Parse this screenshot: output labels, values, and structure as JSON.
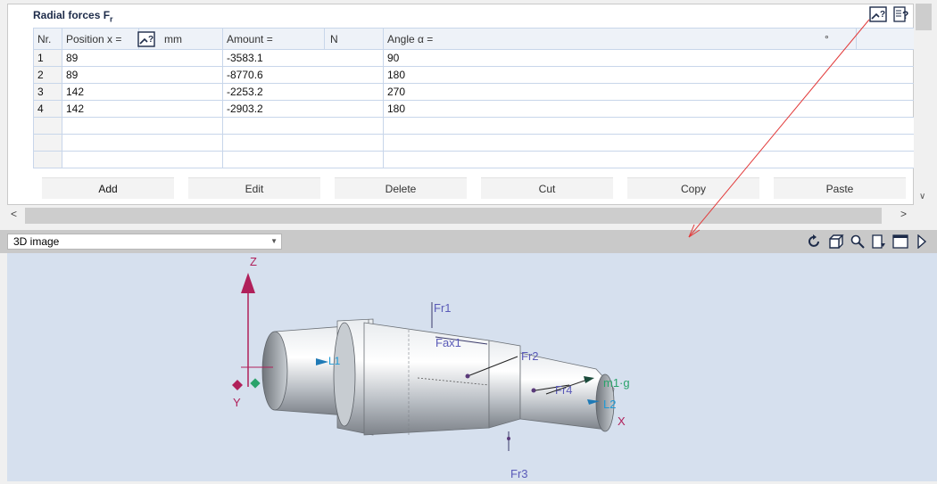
{
  "section": {
    "title": "Radial forces F",
    "title_sub": "r"
  },
  "table": {
    "headers": {
      "nr": "Nr.",
      "position": "Position x =",
      "position_unit": "mm",
      "amount": "Amount =",
      "amount_unit": "N",
      "angle": "Angle α =",
      "angle_unit": "°"
    },
    "rows": [
      {
        "nr": "1",
        "position": "89",
        "amount": "-3583.1",
        "angle": "90"
      },
      {
        "nr": "2",
        "position": "89",
        "amount": "-8770.6",
        "angle": "180"
      },
      {
        "nr": "3",
        "position": "142",
        "amount": "-2253.2",
        "angle": "270"
      },
      {
        "nr": "4",
        "position": "142",
        "amount": "-2903.2",
        "angle": "180"
      }
    ]
  },
  "buttons": {
    "add": "Add",
    "edit": "Edit",
    "delete": "Delete",
    "cut": "Cut",
    "copy": "Copy",
    "paste": "Paste"
  },
  "view3d": {
    "selected": "3D image"
  },
  "scene_labels": {
    "z": "Z",
    "y": "Y",
    "x": "X",
    "fr1": "Fr1",
    "fax1": "Fax1",
    "fr2": "Fr2",
    "fr3": "Fr3",
    "fr4": "Fr4",
    "m1g": "m1·g",
    "l1": "L1",
    "l2": "L2"
  },
  "colors": {
    "accent_navy": "#1d2b49",
    "force_blue": "#5a5ab8",
    "bearing_cyan": "#1f9ad6",
    "gravity_green": "#2aa36b",
    "axis_magenta": "#b0205a",
    "pointer_red": "#e23b3b"
  },
  "icons": [
    "chart-input-icon",
    "help-icon",
    "rotate-icon",
    "cube-icon",
    "zoom-icon",
    "export-icon",
    "window-icon",
    "play-icon"
  ]
}
